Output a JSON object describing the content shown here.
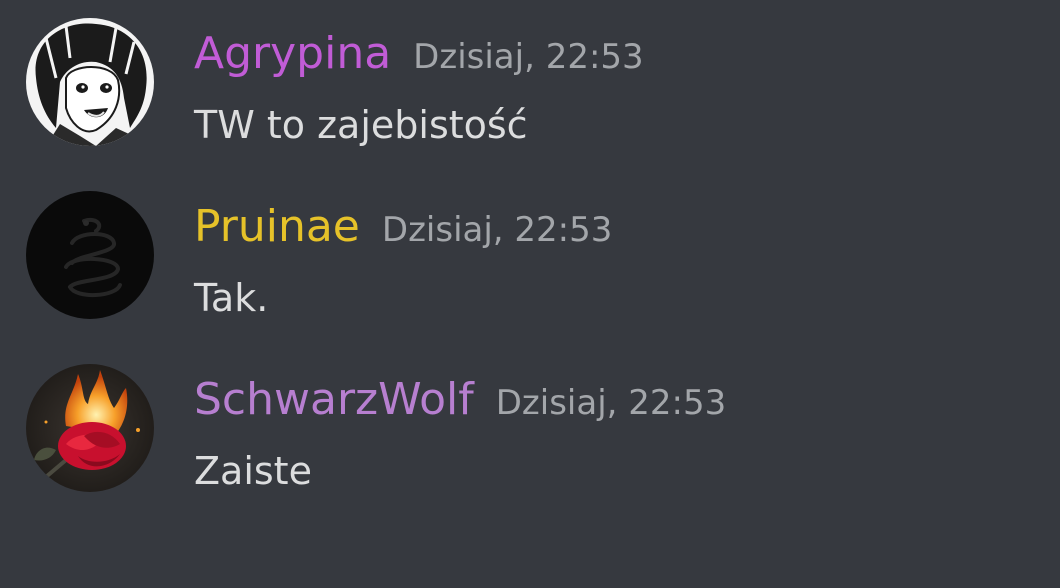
{
  "messages": [
    {
      "username": "Agrypina",
      "username_color": "#c15cd6",
      "timestamp": "Dzisiaj, 22:53",
      "content": "TW to zajebistość",
      "avatar_icon": "anime-character-avatar-icon"
    },
    {
      "username": "Pruinae",
      "username_color": "#e6c229",
      "timestamp": "Dzisiaj, 22:53",
      "content": "Tak.",
      "avatar_icon": "coiled-snake-avatar-icon"
    },
    {
      "username": "SchwarzWolf",
      "username_color": "#b77fd0",
      "timestamp": "Dzisiaj, 22:53",
      "content": "Zaiste",
      "avatar_icon": "burning-rose-avatar-icon"
    }
  ],
  "colors": {
    "background": "#36393f",
    "timestamp": "#a3a6aa",
    "message_text": "#dcddde"
  }
}
